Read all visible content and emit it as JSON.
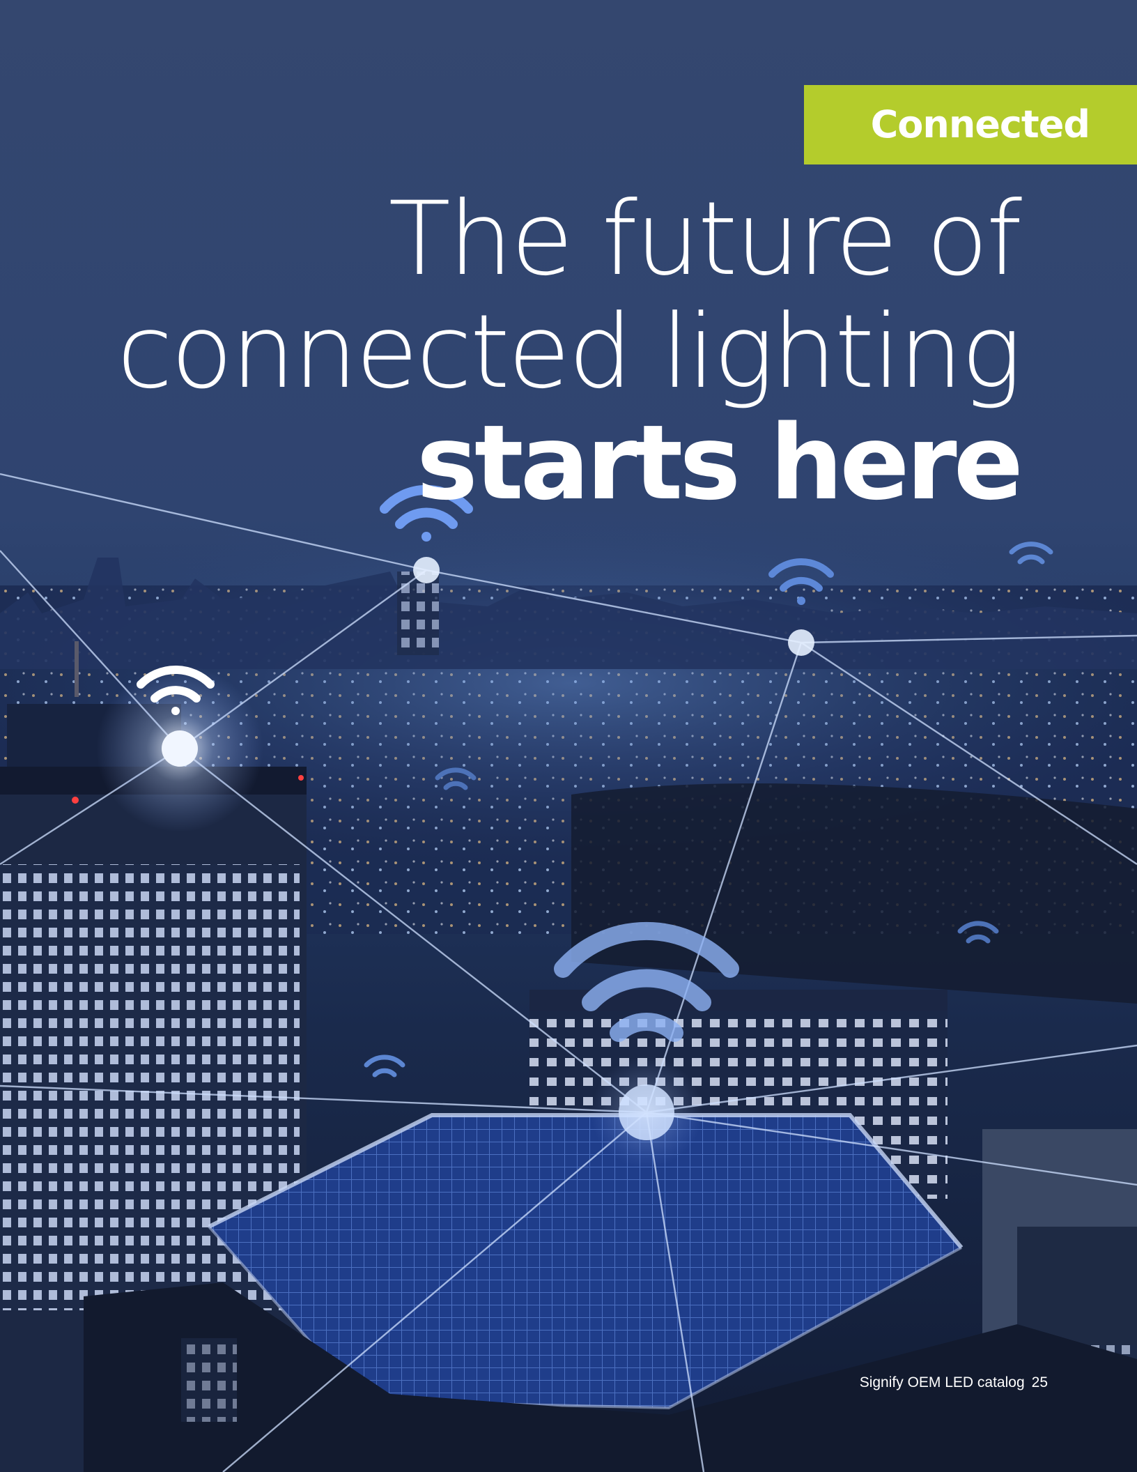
{
  "tag": {
    "label": "Connected"
  },
  "headline": {
    "line1": "The future of",
    "line2": "connected lighting",
    "line3": "starts here"
  },
  "footer": {
    "publication": "Signify OEM LED catalog",
    "page_number": "25"
  },
  "colors": {
    "tag_background": "#b4cc2c",
    "sky": "#2f4470",
    "text": "#ffffff",
    "network": "#cfe0ff"
  },
  "icons": [
    "wifi-icon",
    "network-node"
  ]
}
